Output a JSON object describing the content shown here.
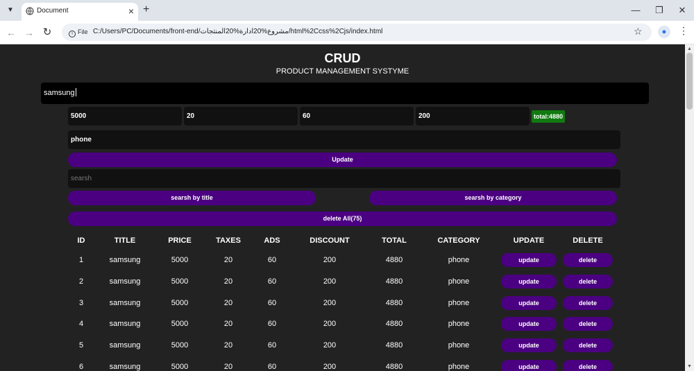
{
  "browser": {
    "tab_title": "Document",
    "url_chip": "File",
    "url": "C:/Users/PC/Documents/front-end/مشروع%20ادارة%20المنتجات/html%2Ccss%2Cjs/index.html"
  },
  "header": {
    "title": "CRUD",
    "subtitle": "PRODUCT MANAGEMENT SYSTYME"
  },
  "form": {
    "title_value": "samsung",
    "price": "5000",
    "taxes": "20",
    "ads": "60",
    "discount": "200",
    "total_label": "total:4880",
    "total_color": "#107a10",
    "category": "phone",
    "submit_label": "Update",
    "search_placeholder": "searsh",
    "search_by_title": "searsh by title",
    "search_by_category": "searsh by category",
    "delete_all": "delete All(75)"
  },
  "theme": {
    "background": "#222222",
    "accent": "#4b0082"
  },
  "table": {
    "headers": [
      "ID",
      "TITLE",
      "PRICE",
      "TAXES",
      "ADS",
      "DISCOUNT",
      "TOTAL",
      "CATEGORY",
      "UPDATE",
      "DELETE"
    ],
    "update_label": "update",
    "delete_label": "delete",
    "rows": [
      [
        "1",
        "samsung",
        "5000",
        "20",
        "60",
        "200",
        "4880",
        "phone"
      ],
      [
        "2",
        "samsung",
        "5000",
        "20",
        "60",
        "200",
        "4880",
        "phone"
      ],
      [
        "3",
        "samsung",
        "5000",
        "20",
        "60",
        "200",
        "4880",
        "phone"
      ],
      [
        "4",
        "samsung",
        "5000",
        "20",
        "60",
        "200",
        "4880",
        "phone"
      ],
      [
        "5",
        "samsung",
        "5000",
        "20",
        "60",
        "200",
        "4880",
        "phone"
      ],
      [
        "6",
        "samsung",
        "5000",
        "20",
        "60",
        "200",
        "4880",
        "phone"
      ]
    ]
  }
}
